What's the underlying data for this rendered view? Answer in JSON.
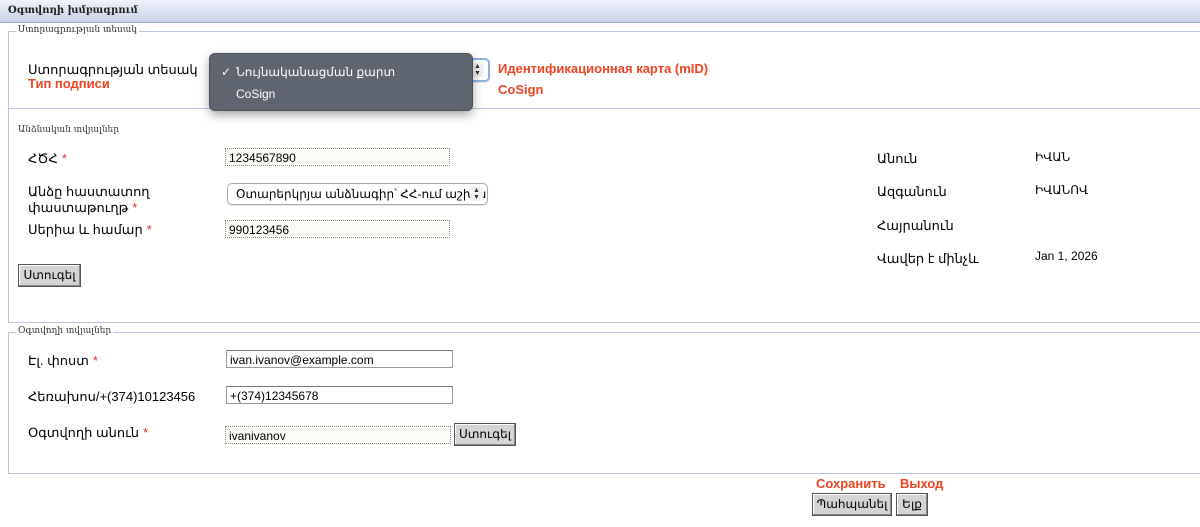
{
  "window": {
    "title": "Օգտվողի խմբագրում"
  },
  "signature_section": {
    "legend": "Ստորագրության տեսակ",
    "label": "Ստորագրության տեսակ",
    "label_translation": "Тип подписи",
    "dropdown": {
      "options": [
        "Նույնականացման քարտ",
        "CoSign"
      ],
      "selected_index": 0
    },
    "translations": [
      "Идентификационная карта (mID)",
      "CoSign"
    ]
  },
  "personal_section": {
    "legend": "Անձնական տվյալներ",
    "ssn": {
      "label": "ՀԾՀ",
      "required_mark": "*",
      "value": "1234567890"
    },
    "id_doc": {
      "label_line1": "Անձը հաստատող",
      "label_line2": "փաստաթուղթ",
      "required_mark": "*",
      "selected": "Օտարերկրյա անձնագիր՝ ՀՀ-ում աշխատ"
    },
    "series": {
      "label": "Սերիա և համար",
      "required_mark": "*",
      "value": "990123456"
    },
    "check_button": "Ստուգել",
    "info": {
      "first_name": {
        "label": "Անուն",
        "value": "ԻՎԱՆ"
      },
      "last_name": {
        "label": "Ազգանուն",
        "value": "ԻՎԱՆՈՎ"
      },
      "patronymic": {
        "label": "Հայրանուն",
        "value": ""
      },
      "valid_until": {
        "label": "Վավեր է մինչև",
        "value": "Jan 1, 2026"
      }
    }
  },
  "user_section": {
    "legend": "Օգտվողի տվյալներ",
    "email": {
      "label": "Էլ. փոստ",
      "required_mark": "*",
      "value": "ivan.ivanov@example.com"
    },
    "phone": {
      "label": "Հեռախոս/+(374)10123456",
      "value": "+(374)12345678"
    },
    "username": {
      "label": "Օգտվողի անուն",
      "required_mark": "*",
      "value": "ivanivanov"
    },
    "check_button": "Ստուգել"
  },
  "footer": {
    "save_translation": "Сохранить",
    "exit_translation": "Выход",
    "save_button": "Պահպանել",
    "exit_button": "Ելք"
  }
}
